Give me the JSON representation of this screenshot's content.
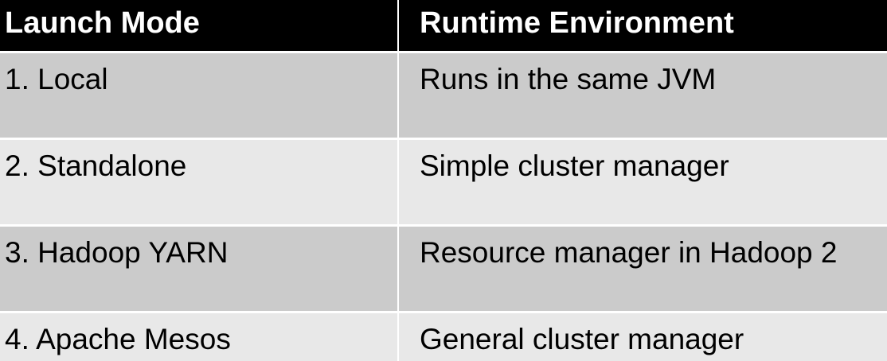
{
  "table": {
    "headers": [
      "Launch Mode",
      "Runtime Environment"
    ],
    "rows": [
      [
        "1. Local",
        "Runs in the same JVM"
      ],
      [
        "2. Standalone",
        "Simple cluster manager"
      ],
      [
        "3. Hadoop YARN",
        "Resource manager in Hadoop 2"
      ],
      [
        "4. Apache Mesos",
        "General cluster manager"
      ]
    ]
  },
  "colors": {
    "header_bg": "#000000",
    "header_text": "#ffffff",
    "row_dark": "#cbcbcb",
    "row_light": "#e8e8e8",
    "separator": "#ffffff"
  }
}
